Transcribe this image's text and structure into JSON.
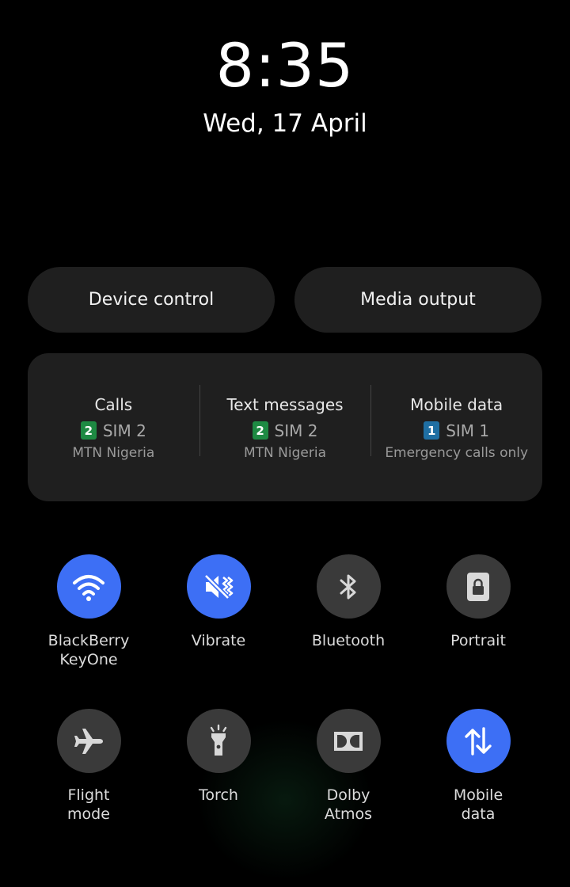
{
  "clock": {
    "time": "8:35",
    "date": "Wed, 17 April"
  },
  "buttons": {
    "device_control": "Device control",
    "media_output": "Media output"
  },
  "sim_settings": [
    {
      "title": "Calls",
      "sim_number": "2",
      "sim_label": "SIM 2",
      "carrier": "MTN Nigeria",
      "badge_color": "#1e8a43"
    },
    {
      "title": "Text messages",
      "sim_number": "2",
      "sim_label": "SIM 2",
      "carrier": "MTN Nigeria",
      "badge_color": "#1e8a43"
    },
    {
      "title": "Mobile data",
      "sim_number": "1",
      "sim_label": "SIM 1",
      "carrier": "Emergency calls only",
      "badge_color": "#1f6fa3"
    }
  ],
  "tiles": [
    {
      "label": "BlackBerry\nKeyOne",
      "icon": "wifi-icon",
      "active": true
    },
    {
      "label": "Vibrate",
      "icon": "vibrate-icon",
      "active": true
    },
    {
      "label": "Bluetooth",
      "icon": "bluetooth-icon",
      "active": false
    },
    {
      "label": "Portrait",
      "icon": "portrait-lock-icon",
      "active": false
    },
    {
      "label": "Flight\nmode",
      "icon": "airplane-icon",
      "active": false
    },
    {
      "label": "Torch",
      "icon": "torch-icon",
      "active": false
    },
    {
      "label": "Dolby\nAtmos",
      "icon": "dolby-icon",
      "active": false
    },
    {
      "label": "Mobile\ndata",
      "icon": "mobile-data-icon",
      "active": true
    }
  ],
  "colors": {
    "active": "#3d6ff5",
    "inactive": "#3a3a3a",
    "panel": "#1f1f1f"
  }
}
